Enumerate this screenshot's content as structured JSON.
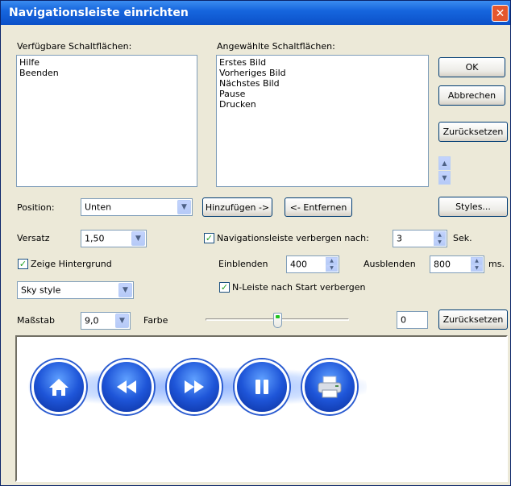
{
  "window": {
    "title": "Navigationsleiste einrichten",
    "close_glyph": "✕"
  },
  "available": {
    "label": "Verfügbare Schaltflächen:",
    "items": [
      "Hilfe",
      "Beenden"
    ]
  },
  "selected": {
    "label": "Angewählte Schaltflächen:",
    "items": [
      "Erstes Bild",
      "Vorheriges Bild",
      "Nächstes Bild",
      "Pause",
      "Drucken"
    ]
  },
  "buttons": {
    "ok": "OK",
    "cancel": "Abbrechen",
    "reset": "Zurücksetzen",
    "add": "Hinzufügen ->",
    "remove": "<- Entfernen",
    "styles": "Styles...",
    "reset2": "Zurücksetzen"
  },
  "position": {
    "label": "Position:",
    "value": "Unten"
  },
  "versatz": {
    "label": "Versatz",
    "value": "1,50"
  },
  "hide_nav": {
    "label": "Navigationsleiste verbergen nach:",
    "checked": true,
    "value": "3",
    "unit": "Sek."
  },
  "show_bg": {
    "label": "Zeige Hintergrund",
    "checked": true
  },
  "fade": {
    "in_label": "Einblenden",
    "in_value": "400",
    "out_label": "Ausblenden",
    "out_value": "800",
    "unit": "ms."
  },
  "style_select": {
    "value": "Sky style"
  },
  "hide_after_start": {
    "label": "N-Leiste nach Start verbergen",
    "checked": true
  },
  "scale": {
    "label": "Maßstab",
    "value": "9,0"
  },
  "color": {
    "label": "Farbe",
    "slider_level": 0.48,
    "value": "0"
  },
  "preview": {
    "icons": [
      "home-icon",
      "rewind-icon",
      "fast-forward-icon",
      "pause-icon",
      "print-icon"
    ]
  },
  "colors": {
    "titlebar": "#0B50C8",
    "accent": "#1E55D8",
    "check": "#21A121"
  }
}
